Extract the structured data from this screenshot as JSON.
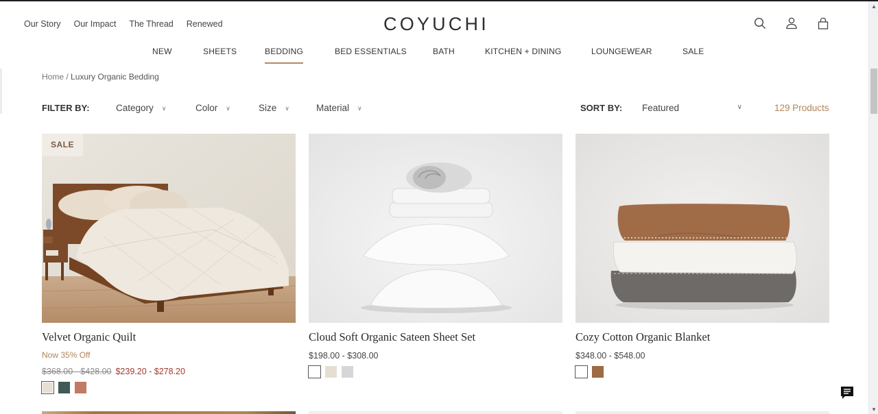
{
  "header": {
    "utility_nav": [
      "Our Story",
      "Our Impact",
      "The Thread",
      "Renewed"
    ],
    "logo": "COYUCHI",
    "icons": [
      "search-icon",
      "account-icon",
      "cart-icon"
    ]
  },
  "main_nav": {
    "items": [
      "NEW",
      "SHEETS",
      "BEDDING",
      "BED ESSENTIALS",
      "BATH",
      "KITCHEN + DINING",
      "LOUNGEWEAR",
      "SALE"
    ],
    "active": "BEDDING",
    "accent_color": "#b08a68"
  },
  "breadcrumb": {
    "home": "Home",
    "separator": " / ",
    "current": "Luxury Organic Bedding"
  },
  "filters": {
    "label": "FILTER BY:",
    "options": [
      "Category",
      "Color",
      "Size",
      "Material"
    ]
  },
  "sort": {
    "label": "SORT BY:",
    "selected": "Featured"
  },
  "product_count": "129 Products",
  "products": [
    {
      "title": "Velvet Organic Quilt",
      "badge": "SALE",
      "promo": "Now 35% Off",
      "original_price": "$368.00 - $428.00",
      "sale_price": "$239.20 - $278.20",
      "swatches": [
        "#e6dfd4",
        "#3f5a57",
        "#c27a62"
      ],
      "selected_swatch": 0,
      "image": "bed-with-quilt-photo"
    },
    {
      "title": "Cloud Soft Organic Sateen Sheet Set",
      "price": "$198.00 - $308.00",
      "swatches": [
        "#ffffff",
        "#e6ded2",
        "#d6d6d6"
      ],
      "selected_swatch": 0,
      "image": "stacked-sheets-pillows-photo"
    },
    {
      "title": "Cozy Cotton Organic Blanket",
      "price": "$348.00 - $548.00",
      "swatches": [
        "#ffffff",
        "#9c6a43"
      ],
      "selected_swatch": 0,
      "image": "folded-blankets-photo"
    }
  ],
  "chat": {
    "icon": "chat-icon"
  }
}
